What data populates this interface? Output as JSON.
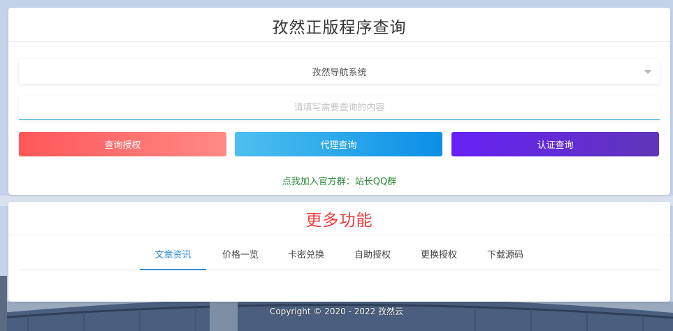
{
  "header": {
    "title": "孜然正版程序查询"
  },
  "query": {
    "selected_program": "孜然导航系统",
    "placeholder": "请填写需要查询的内容"
  },
  "buttons": {
    "auth_query": "查询授权",
    "agent_query": "代理查询",
    "cert_query": "认证查询"
  },
  "join_group_text": "点我加入官方群：站长QQ群",
  "more": {
    "title": "更多功能",
    "tabs": [
      {
        "label": "文章资讯",
        "active": true
      },
      {
        "label": "价格一览",
        "active": false
      },
      {
        "label": "卡密兑换",
        "active": false
      },
      {
        "label": "自助授权",
        "active": false
      },
      {
        "label": "更换授权",
        "active": false
      },
      {
        "label": "下载源码",
        "active": false
      }
    ]
  },
  "footer": {
    "copyright": "Copyright © 2020 - 2022 孜然云"
  },
  "colors": {
    "auth_button": "#ff5758",
    "agent_button": "#0a8fe6",
    "cert_button": "#6622f5",
    "more_title": "#ef3b3b",
    "active_tab": "#2e8bd6",
    "join_link": "#2d8a3e"
  }
}
